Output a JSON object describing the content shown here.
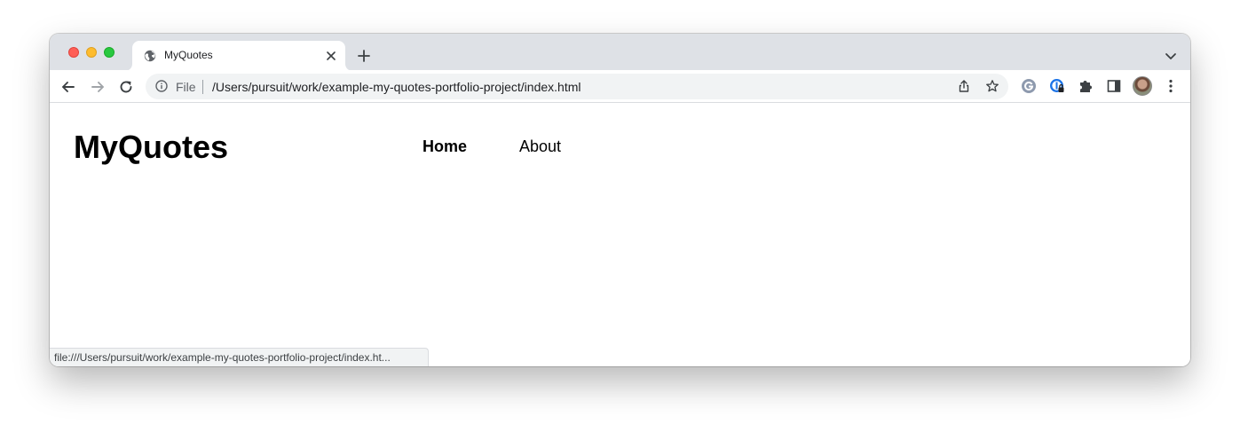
{
  "browser": {
    "tab": {
      "title": "MyQuotes",
      "favicon": "globe-icon"
    },
    "address_bar": {
      "scheme_label": "File",
      "url": "/Users/pursuit/work/example-my-quotes-portfolio-project/index.html"
    },
    "status_bar_url": "file:///Users/pursuit/work/example-my-quotes-portfolio-project/index.ht..."
  },
  "page": {
    "logo": "MyQuotes",
    "nav": [
      {
        "label": "Home",
        "active": true
      },
      {
        "label": "About",
        "active": false
      }
    ]
  },
  "colors": {
    "titlebar": "#dee1e6",
    "omnibox": "#f1f3f4",
    "close": "#ff5f57",
    "minimize": "#febc2e",
    "maximize": "#28c840"
  }
}
